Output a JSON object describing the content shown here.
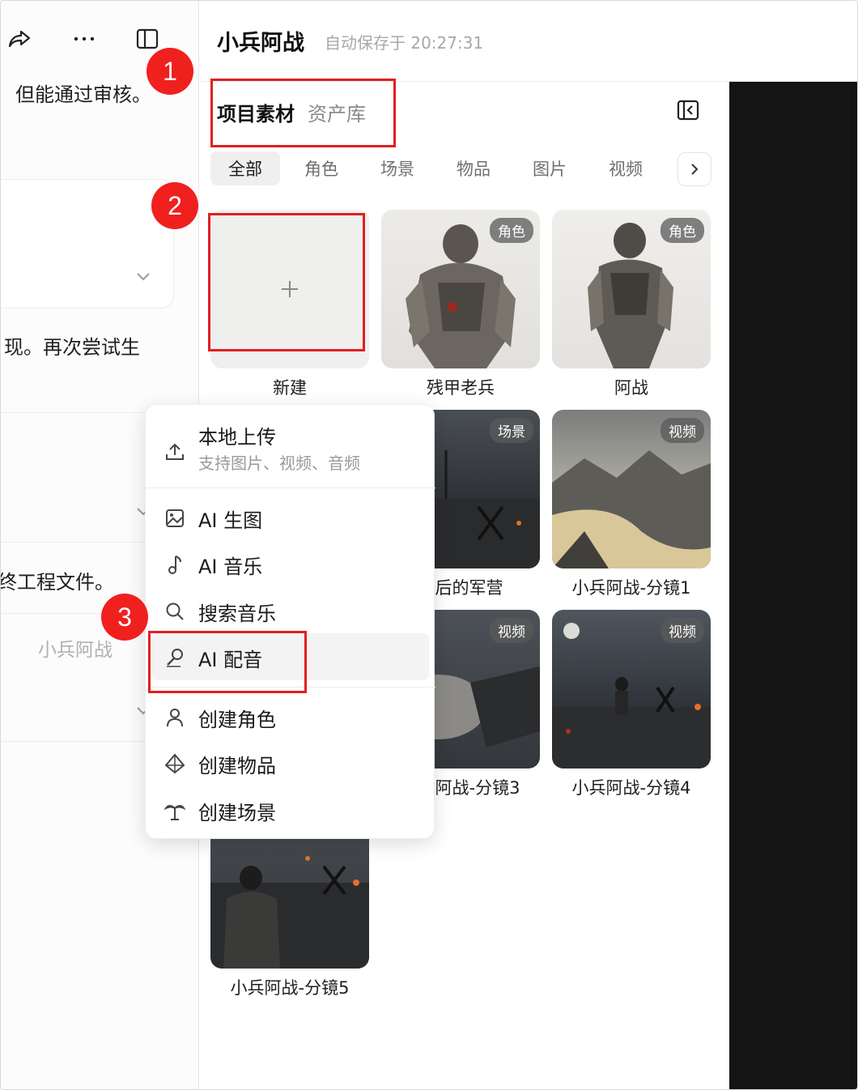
{
  "left_panel": {
    "text_1": "但能通过审核。",
    "text_2": "现。再次尝试生",
    "text_3": "终工程文件。",
    "text_4": "小兵阿战"
  },
  "header": {
    "project_title": "小兵阿战",
    "autosave": "自动保存于 20:27:31"
  },
  "tabs": {
    "project_assets": "项目素材",
    "asset_library": "资产库"
  },
  "filters": [
    "全部",
    "角色",
    "场景",
    "物品",
    "图片",
    "视频"
  ],
  "assets": {
    "new_label": "新建",
    "items": [
      {
        "name": "残甲老兵",
        "badge": "角色"
      },
      {
        "name": "阿战",
        "badge": "角色"
      },
      {
        "name": "战后的军营",
        "badge": "场景"
      },
      {
        "name": "小兵阿战-分镜1",
        "badge": "视频"
      },
      {
        "name": "小兵阿战-分镜3",
        "badge": "视频"
      },
      {
        "name": "小兵阿战-分镜4",
        "badge": "视频"
      },
      {
        "name": "小兵阿战-分镜5",
        "badge": ""
      }
    ]
  },
  "menu": {
    "upload_title": "本地上传",
    "upload_sub": "支持图片、视频、音频",
    "ai_image": "AI 生图",
    "ai_music": "AI 音乐",
    "search_music": "搜索音乐",
    "ai_voice": "AI 配音",
    "create_role": "创建角色",
    "create_item": "创建物品",
    "create_scene": "创建场景"
  },
  "annotations": [
    "1",
    "2",
    "3"
  ],
  "colors": {
    "annotation_red": "#e02020",
    "dark_panel": "#141414"
  }
}
